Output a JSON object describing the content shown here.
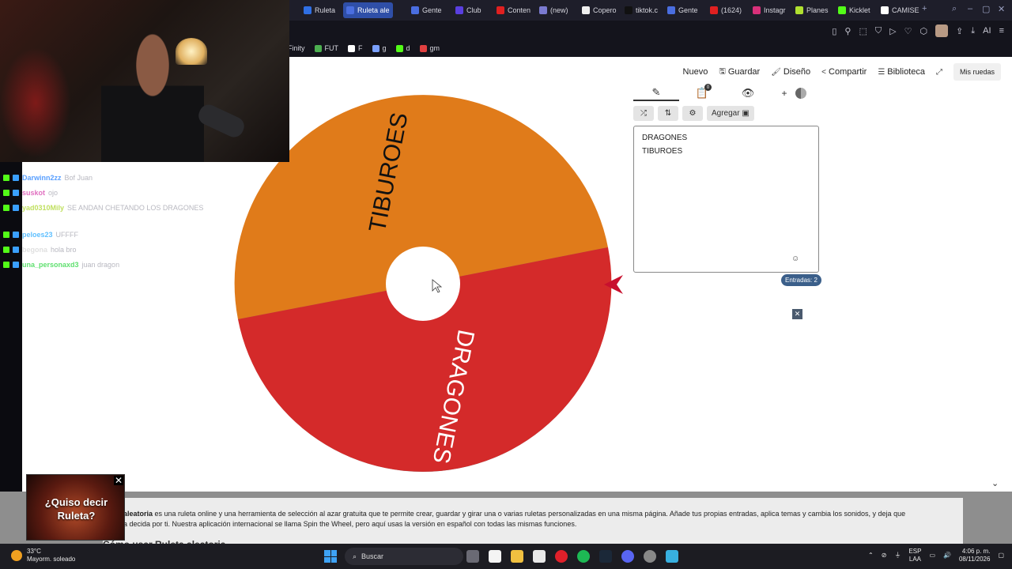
{
  "browser": {
    "tabs": [
      {
        "label": "Ruleta",
        "color": "#2f6fe4"
      },
      {
        "label": "Ruleta ale",
        "color": "#4a6ee0",
        "active": true
      },
      {
        "label": "Gente",
        "color": "#4a6ee0"
      },
      {
        "label": "Club",
        "color": "#5a3fe0"
      },
      {
        "label": "Conten",
        "color": "#e02020"
      },
      {
        "label": "(new)",
        "color": "#7a7ad0"
      },
      {
        "label": "Copero",
        "color": "#f0f0f0"
      },
      {
        "label": "tiktok.c",
        "color": "#111111"
      },
      {
        "label": "Gente",
        "color": "#4a6ee0"
      },
      {
        "label": "(1624)",
        "color": "#e02020"
      },
      {
        "label": "Instagr",
        "color": "#d8307a"
      },
      {
        "label": "Planes",
        "color": "#b0e030"
      },
      {
        "label": "Kicklet",
        "color": "#53fc18"
      },
      {
        "label": "CAMISE",
        "color": "#ffffff"
      }
    ],
    "new_tab": "+",
    "bookmarks": [
      {
        "label": "Finity",
        "color": ""
      },
      {
        "label": "FUT",
        "color": "#4caf50"
      },
      {
        "label": "F",
        "color": "#ffffff"
      },
      {
        "label": "g",
        "color": "#7aa0ff"
      },
      {
        "label": "d",
        "color": "#53fc18"
      },
      {
        "label": "gm",
        "color": "#e04040"
      }
    ]
  },
  "chat": [
    {
      "user": "Darwinn2zz",
      "msg": "Bof Juan",
      "user_color": "#5aa0ff"
    },
    {
      "user": "suskot",
      "msg": "ojo",
      "user_color": "#e070c0"
    },
    {
      "user": "yad0310Mily",
      "msg": "SE ANDAN CHETANDO LOS DRAGONES",
      "user_color": "#c0e060"
    },
    {
      "user": "peloes23",
      "msg": "UFFFF",
      "user_color": "#60c0ff"
    },
    {
      "user": "begona",
      "msg": "hola bro",
      "user_color": "#e0e0e0"
    },
    {
      "user": "una_personaxd3",
      "msg": "juan dragon",
      "user_color": "#60e070"
    }
  ],
  "menu": {
    "nuevo": "Nuevo",
    "guardar": "Guardar",
    "diseno": "Diseño",
    "compartir": "Compartir",
    "biblioteca": "Biblioteca",
    "mis_ruedas": "Mis ruedas"
  },
  "wheel": {
    "segments": [
      {
        "label": "TIBUROES",
        "color": "#e07b1a"
      },
      {
        "label": "DRAGONES",
        "color": "#d42a2a"
      }
    ],
    "pointer_color": "#c8102e"
  },
  "editor": {
    "tab_count": "0",
    "add_button": "Agregar",
    "entries": [
      "DRAGONES",
      "TIBUROES"
    ],
    "entries_count": "Entradas: 2"
  },
  "description": {
    "bold_word": "aleatoria",
    "text": " es una ruleta online y una herramienta de selección al azar gratuita que te permite crear, guardar y girar una o varias ruletas personalizadas en una misma página. Añade tus propias entradas, aplica temas y cambia los sonidos, y deja que",
    "text2": "a decida por ti. Nuestra aplicación internacional se llama Spin the Wheel, pero aquí usas la versión en español con todas las mismas funciones.",
    "heading": "Cómo usar Ruleta aleatoria"
  },
  "promo": {
    "line1": "¿Quiso decir",
    "line2": "Ruleta?"
  },
  "taskbar": {
    "temp": "33°C",
    "weather": "Mayorm. soleado",
    "search": "Buscar",
    "lang1": "ESP",
    "lang2": "LAA",
    "time": "4:06 p. m.",
    "date": "08/11/2026"
  }
}
